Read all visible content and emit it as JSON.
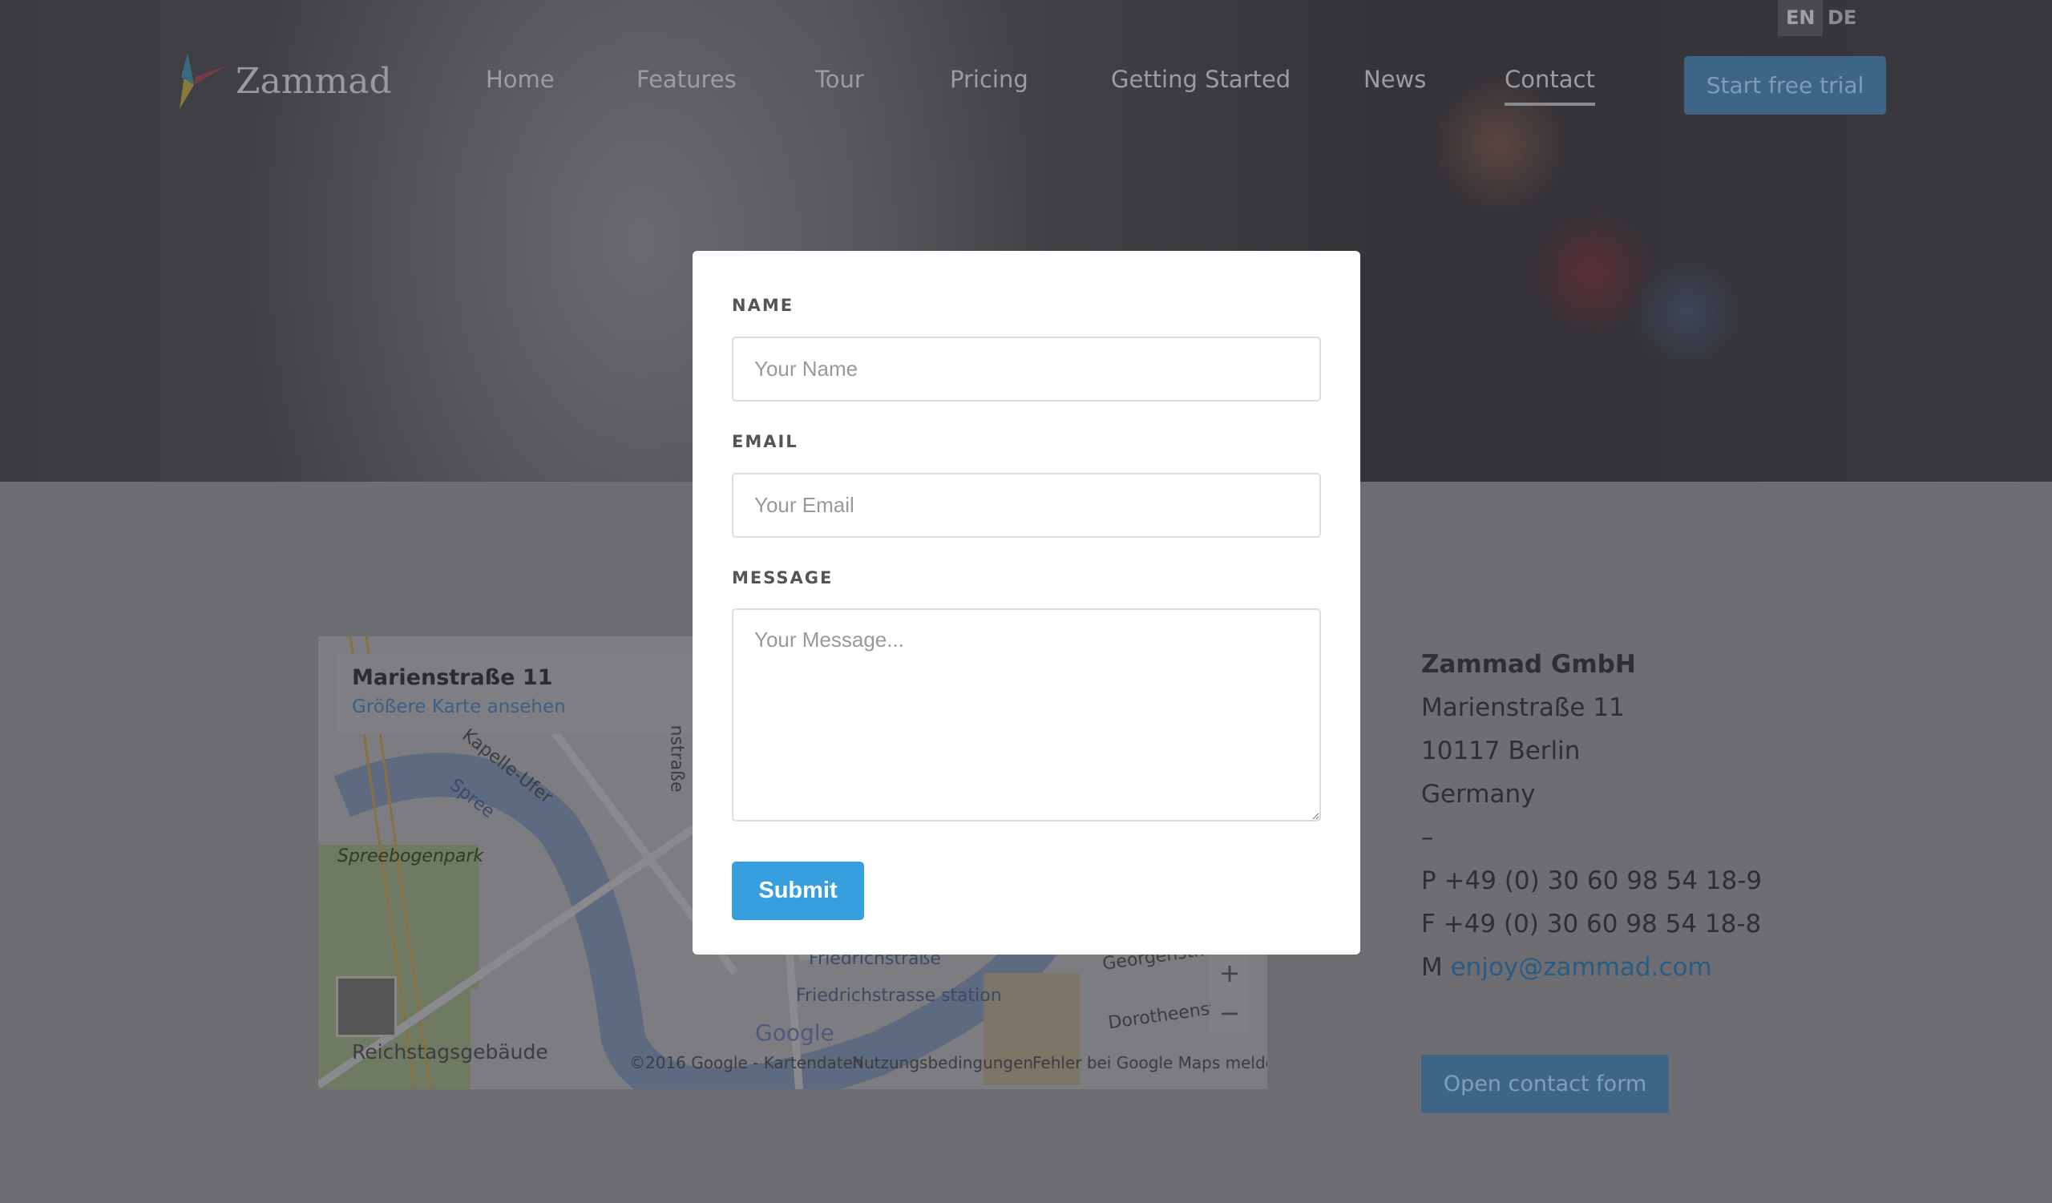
{
  "lang": {
    "en": "EN",
    "de": "DE"
  },
  "brand": "Zammad",
  "nav": [
    {
      "label": "Home"
    },
    {
      "label": "Features"
    },
    {
      "label": "Tour"
    },
    {
      "label": "Pricing"
    },
    {
      "label": "Getting Started"
    },
    {
      "label": "News"
    },
    {
      "label": "Contact",
      "active": true
    }
  ],
  "trial_button": "Start free trial",
  "map": {
    "title": "Marienstraße 11",
    "link": "Größere Karte ansehen",
    "labels": [
      "Kapelle-Ufer",
      "Spree",
      "Spreebogenpark",
      "Reichstagsgebäude",
      "Friedrichstraße",
      "Friedrichstrasse station",
      "Georgenstr.",
      "Dorotheenstr.",
      "nstraße"
    ],
    "attribution": "©2016 Google - Kartendaten",
    "terms": "Nutzungsbedingungen",
    "report": "Fehler bei Google Maps melden",
    "zoom_in": "+",
    "zoom_out": "−",
    "google": "Google"
  },
  "address": {
    "company": "Zammad GmbH",
    "street": "Marienstraße 11",
    "city": "10117 Berlin",
    "country": "Germany",
    "sep": "–",
    "phone": "P +49 (0) 30 60 98 54 18-9",
    "fax": "F +49 (0) 30 60 98 54 18-8",
    "mail_prefix": "M",
    "email": "enjoy@zammad.com"
  },
  "open_form_button": "Open contact form",
  "form": {
    "name_label": "NAME",
    "name_placeholder": "Your Name",
    "email_label": "EMAIL",
    "email_placeholder": "Your Email",
    "message_label": "MESSAGE",
    "message_placeholder": "Your Message...",
    "submit": "Submit"
  }
}
